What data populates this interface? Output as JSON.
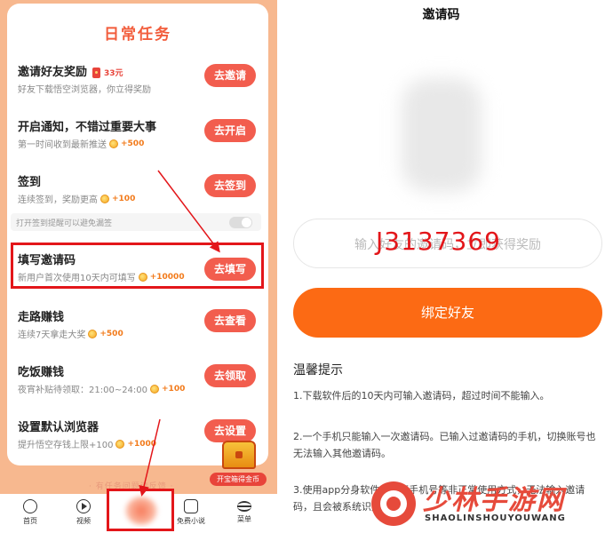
{
  "left": {
    "card_title": "日常任务",
    "tasks": [
      {
        "title": "邀请好友奖励",
        "sub": "好友下载悟空浏览器，你立得奖励",
        "reward": "33元",
        "button": "去邀请"
      },
      {
        "title": "开启通知，不错过重要大事",
        "sub": "第一时间收到最新推送",
        "reward": "+500",
        "button": "去开启"
      },
      {
        "title": "签到",
        "sub": "连续签到，奖励更高",
        "reward": "+100",
        "button": "去签到"
      },
      {
        "title": "填写邀请码",
        "sub": "新用户首次使用10天内可填写",
        "reward": "+10000",
        "button": "去填写"
      },
      {
        "title": "走路赚钱",
        "sub": "连续7天拿走大奖",
        "reward": "+500",
        "button": "去查看"
      },
      {
        "title": "吃饭赚钱",
        "sub": "夜宵补贴待领取：21:00~24:00",
        "reward": "+100",
        "button": "去领取"
      },
      {
        "title": "设置默认浏览器",
        "sub": "提升悟空存钱上限+100",
        "reward": "+1000",
        "button": "去设置"
      }
    ],
    "remind_text": "打开签到提醒可以避免漏签",
    "treasure_label": "开宝箱得金币",
    "bottom_hint": "· 有任务问题请反馈 ·",
    "tabs": [
      {
        "label": "首页",
        "icon": "home-icon"
      },
      {
        "label": "视频",
        "icon": "video-play-icon"
      },
      {
        "label": "免费小说",
        "icon": "book-icon"
      },
      {
        "label": "菜单",
        "icon": "menu-icon"
      }
    ],
    "colors": {
      "accent": "#f25d4e",
      "title": "#f25d3c",
      "highlight": "#e3161a",
      "background": "#f7b88f"
    }
  },
  "right": {
    "title": "邀请码",
    "input_placeholder": "输入好友的邀请码，立即获得奖励",
    "input_value": "J3137369",
    "bind_button": "绑定好友",
    "tips_title": "温馨提示",
    "tips": [
      "1.下载软件后的10天内可输入邀请码，超过时间不能输入。",
      "2.一个手机只能输入一次邀请码。已输入过邀请码的手机，切换账号也无法输入其他邀请码。",
      "3.使用app分身软件或多开手机号等非正常使用方式，无法输入邀请码，且会被系统识别。"
    ],
    "colors": {
      "button": "#fc6a14",
      "code": "#e3161a"
    }
  },
  "watermark": {
    "cn": "少林手游网",
    "en": "SHAOLINSHOUYOUWANG"
  }
}
